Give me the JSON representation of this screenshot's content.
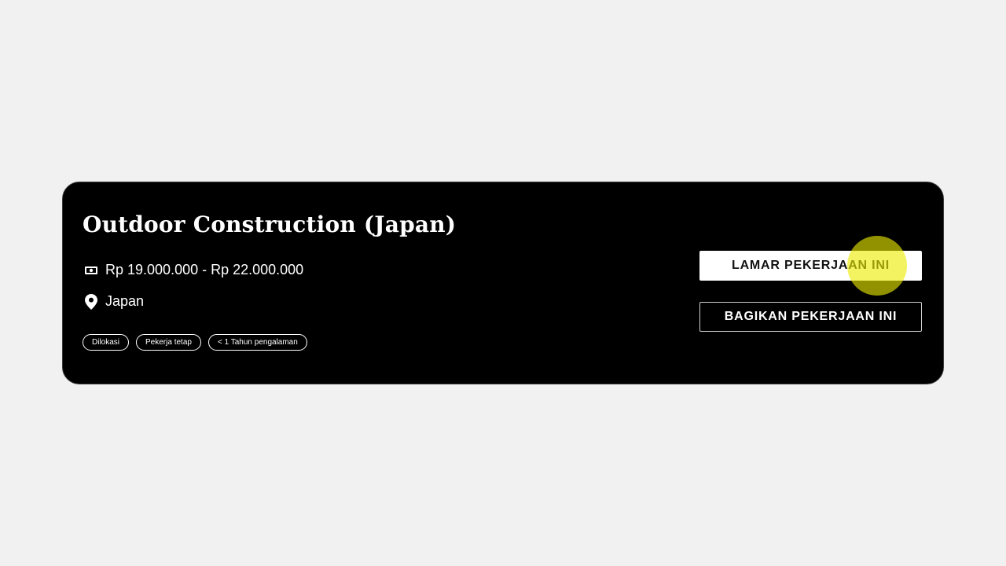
{
  "job": {
    "title": "Outdoor Construction (Japan)",
    "salary": "Rp 19.000.000 - Rp 22.000.000",
    "location": "Japan",
    "tags": [
      "Dilokasi",
      "Pekerja tetap",
      "< 1 Tahun pengalaman"
    ]
  },
  "actions": {
    "apply_label": "LAMAR PEKERJAAN INI",
    "share_label": "BAGIKAN PEKERJAAN INI"
  },
  "icons": {
    "salary": "money-icon",
    "location": "location-pin-icon"
  },
  "colors": {
    "card_background": "#000000",
    "page_background": "#f1f1f1",
    "cursor_highlight": "#ebeb00"
  }
}
